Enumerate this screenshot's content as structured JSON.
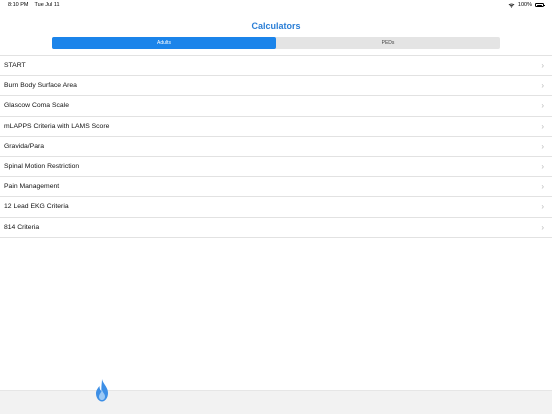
{
  "status": {
    "time": "8:10 PM",
    "date": "Tue Jul 11",
    "battery": "100%"
  },
  "nav": {
    "title": "Calculators"
  },
  "segments": [
    {
      "label": "Adults",
      "selected": true
    },
    {
      "label": "PEDs",
      "selected": false
    }
  ],
  "items": [
    {
      "label": "START"
    },
    {
      "label": "Burn Body Surface Area"
    },
    {
      "label": "Glascow Coma Scale"
    },
    {
      "label": "mLAPPS Criteria with LAMS Score"
    },
    {
      "label": "Gravida/Para"
    },
    {
      "label": "Spinal Motion Restriction"
    },
    {
      "label": "Pain Management"
    },
    {
      "label": "12 Lead EKG Criteria"
    },
    {
      "label": "814 Criteria"
    }
  ],
  "chevron_glyph": "›",
  "colors": {
    "accent": "#1b84ea",
    "title": "#2a7ed6",
    "flame": "#3d8fe6"
  },
  "icons": {
    "flame": "flame-icon"
  }
}
